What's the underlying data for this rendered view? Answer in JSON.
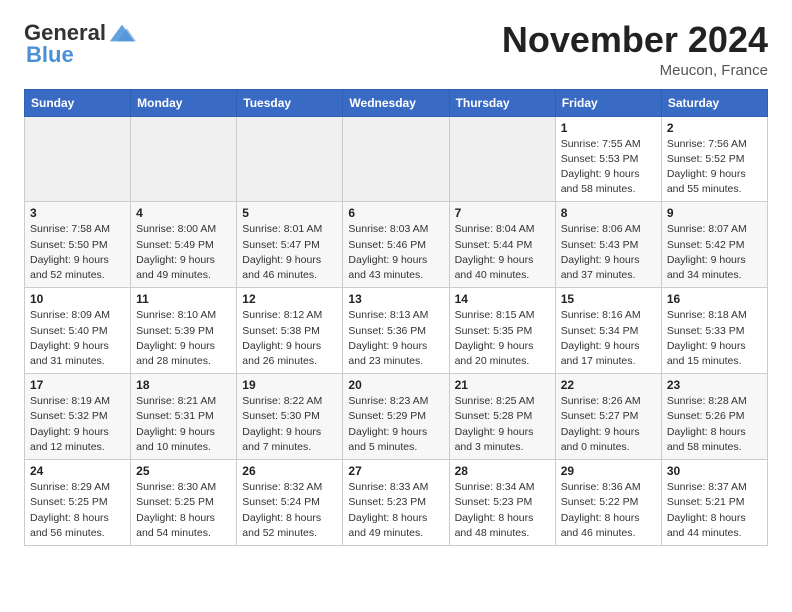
{
  "logo": {
    "general": "General",
    "blue": "Blue"
  },
  "header": {
    "month": "November 2024",
    "location": "Meucon, France"
  },
  "weekdays": [
    "Sunday",
    "Monday",
    "Tuesday",
    "Wednesday",
    "Thursday",
    "Friday",
    "Saturday"
  ],
  "weeks": [
    [
      {
        "day": "",
        "info": ""
      },
      {
        "day": "",
        "info": ""
      },
      {
        "day": "",
        "info": ""
      },
      {
        "day": "",
        "info": ""
      },
      {
        "day": "",
        "info": ""
      },
      {
        "day": "1",
        "info": "Sunrise: 7:55 AM\nSunset: 5:53 PM\nDaylight: 9 hours and 58 minutes."
      },
      {
        "day": "2",
        "info": "Sunrise: 7:56 AM\nSunset: 5:52 PM\nDaylight: 9 hours and 55 minutes."
      }
    ],
    [
      {
        "day": "3",
        "info": "Sunrise: 7:58 AM\nSunset: 5:50 PM\nDaylight: 9 hours and 52 minutes."
      },
      {
        "day": "4",
        "info": "Sunrise: 8:00 AM\nSunset: 5:49 PM\nDaylight: 9 hours and 49 minutes."
      },
      {
        "day": "5",
        "info": "Sunrise: 8:01 AM\nSunset: 5:47 PM\nDaylight: 9 hours and 46 minutes."
      },
      {
        "day": "6",
        "info": "Sunrise: 8:03 AM\nSunset: 5:46 PM\nDaylight: 9 hours and 43 minutes."
      },
      {
        "day": "7",
        "info": "Sunrise: 8:04 AM\nSunset: 5:44 PM\nDaylight: 9 hours and 40 minutes."
      },
      {
        "day": "8",
        "info": "Sunrise: 8:06 AM\nSunset: 5:43 PM\nDaylight: 9 hours and 37 minutes."
      },
      {
        "day": "9",
        "info": "Sunrise: 8:07 AM\nSunset: 5:42 PM\nDaylight: 9 hours and 34 minutes."
      }
    ],
    [
      {
        "day": "10",
        "info": "Sunrise: 8:09 AM\nSunset: 5:40 PM\nDaylight: 9 hours and 31 minutes."
      },
      {
        "day": "11",
        "info": "Sunrise: 8:10 AM\nSunset: 5:39 PM\nDaylight: 9 hours and 28 minutes."
      },
      {
        "day": "12",
        "info": "Sunrise: 8:12 AM\nSunset: 5:38 PM\nDaylight: 9 hours and 26 minutes."
      },
      {
        "day": "13",
        "info": "Sunrise: 8:13 AM\nSunset: 5:36 PM\nDaylight: 9 hours and 23 minutes."
      },
      {
        "day": "14",
        "info": "Sunrise: 8:15 AM\nSunset: 5:35 PM\nDaylight: 9 hours and 20 minutes."
      },
      {
        "day": "15",
        "info": "Sunrise: 8:16 AM\nSunset: 5:34 PM\nDaylight: 9 hours and 17 minutes."
      },
      {
        "day": "16",
        "info": "Sunrise: 8:18 AM\nSunset: 5:33 PM\nDaylight: 9 hours and 15 minutes."
      }
    ],
    [
      {
        "day": "17",
        "info": "Sunrise: 8:19 AM\nSunset: 5:32 PM\nDaylight: 9 hours and 12 minutes."
      },
      {
        "day": "18",
        "info": "Sunrise: 8:21 AM\nSunset: 5:31 PM\nDaylight: 9 hours and 10 minutes."
      },
      {
        "day": "19",
        "info": "Sunrise: 8:22 AM\nSunset: 5:30 PM\nDaylight: 9 hours and 7 minutes."
      },
      {
        "day": "20",
        "info": "Sunrise: 8:23 AM\nSunset: 5:29 PM\nDaylight: 9 hours and 5 minutes."
      },
      {
        "day": "21",
        "info": "Sunrise: 8:25 AM\nSunset: 5:28 PM\nDaylight: 9 hours and 3 minutes."
      },
      {
        "day": "22",
        "info": "Sunrise: 8:26 AM\nSunset: 5:27 PM\nDaylight: 9 hours and 0 minutes."
      },
      {
        "day": "23",
        "info": "Sunrise: 8:28 AM\nSunset: 5:26 PM\nDaylight: 8 hours and 58 minutes."
      }
    ],
    [
      {
        "day": "24",
        "info": "Sunrise: 8:29 AM\nSunset: 5:25 PM\nDaylight: 8 hours and 56 minutes."
      },
      {
        "day": "25",
        "info": "Sunrise: 8:30 AM\nSunset: 5:25 PM\nDaylight: 8 hours and 54 minutes."
      },
      {
        "day": "26",
        "info": "Sunrise: 8:32 AM\nSunset: 5:24 PM\nDaylight: 8 hours and 52 minutes."
      },
      {
        "day": "27",
        "info": "Sunrise: 8:33 AM\nSunset: 5:23 PM\nDaylight: 8 hours and 49 minutes."
      },
      {
        "day": "28",
        "info": "Sunrise: 8:34 AM\nSunset: 5:23 PM\nDaylight: 8 hours and 48 minutes."
      },
      {
        "day": "29",
        "info": "Sunrise: 8:36 AM\nSunset: 5:22 PM\nDaylight: 8 hours and 46 minutes."
      },
      {
        "day": "30",
        "info": "Sunrise: 8:37 AM\nSunset: 5:21 PM\nDaylight: 8 hours and 44 minutes."
      }
    ]
  ]
}
